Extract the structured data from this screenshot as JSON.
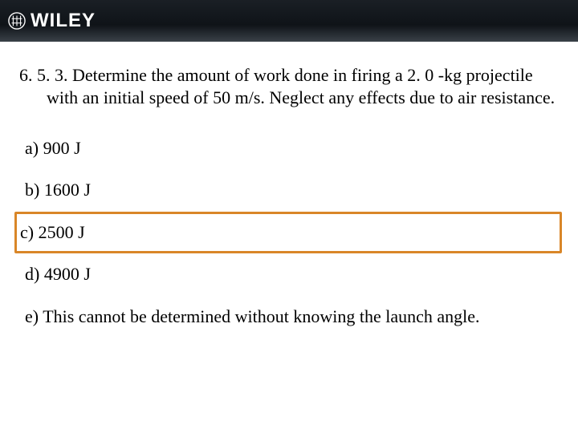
{
  "header": {
    "brand": "WILEY"
  },
  "question": {
    "number": "6. 5. 3.",
    "text": "Determine the amount of work done in firing a 2. 0 -kg projectile with an initial speed of 50 m/s.  Neglect any effects due to air resistance."
  },
  "options": {
    "a": "a)  900 J",
    "b": "b)  1600 J",
    "c": "c)  2500 J",
    "d": "d)  4900 J",
    "e": "e)  This cannot be determined without knowing the launch angle."
  },
  "highlight_color": "#d98628"
}
